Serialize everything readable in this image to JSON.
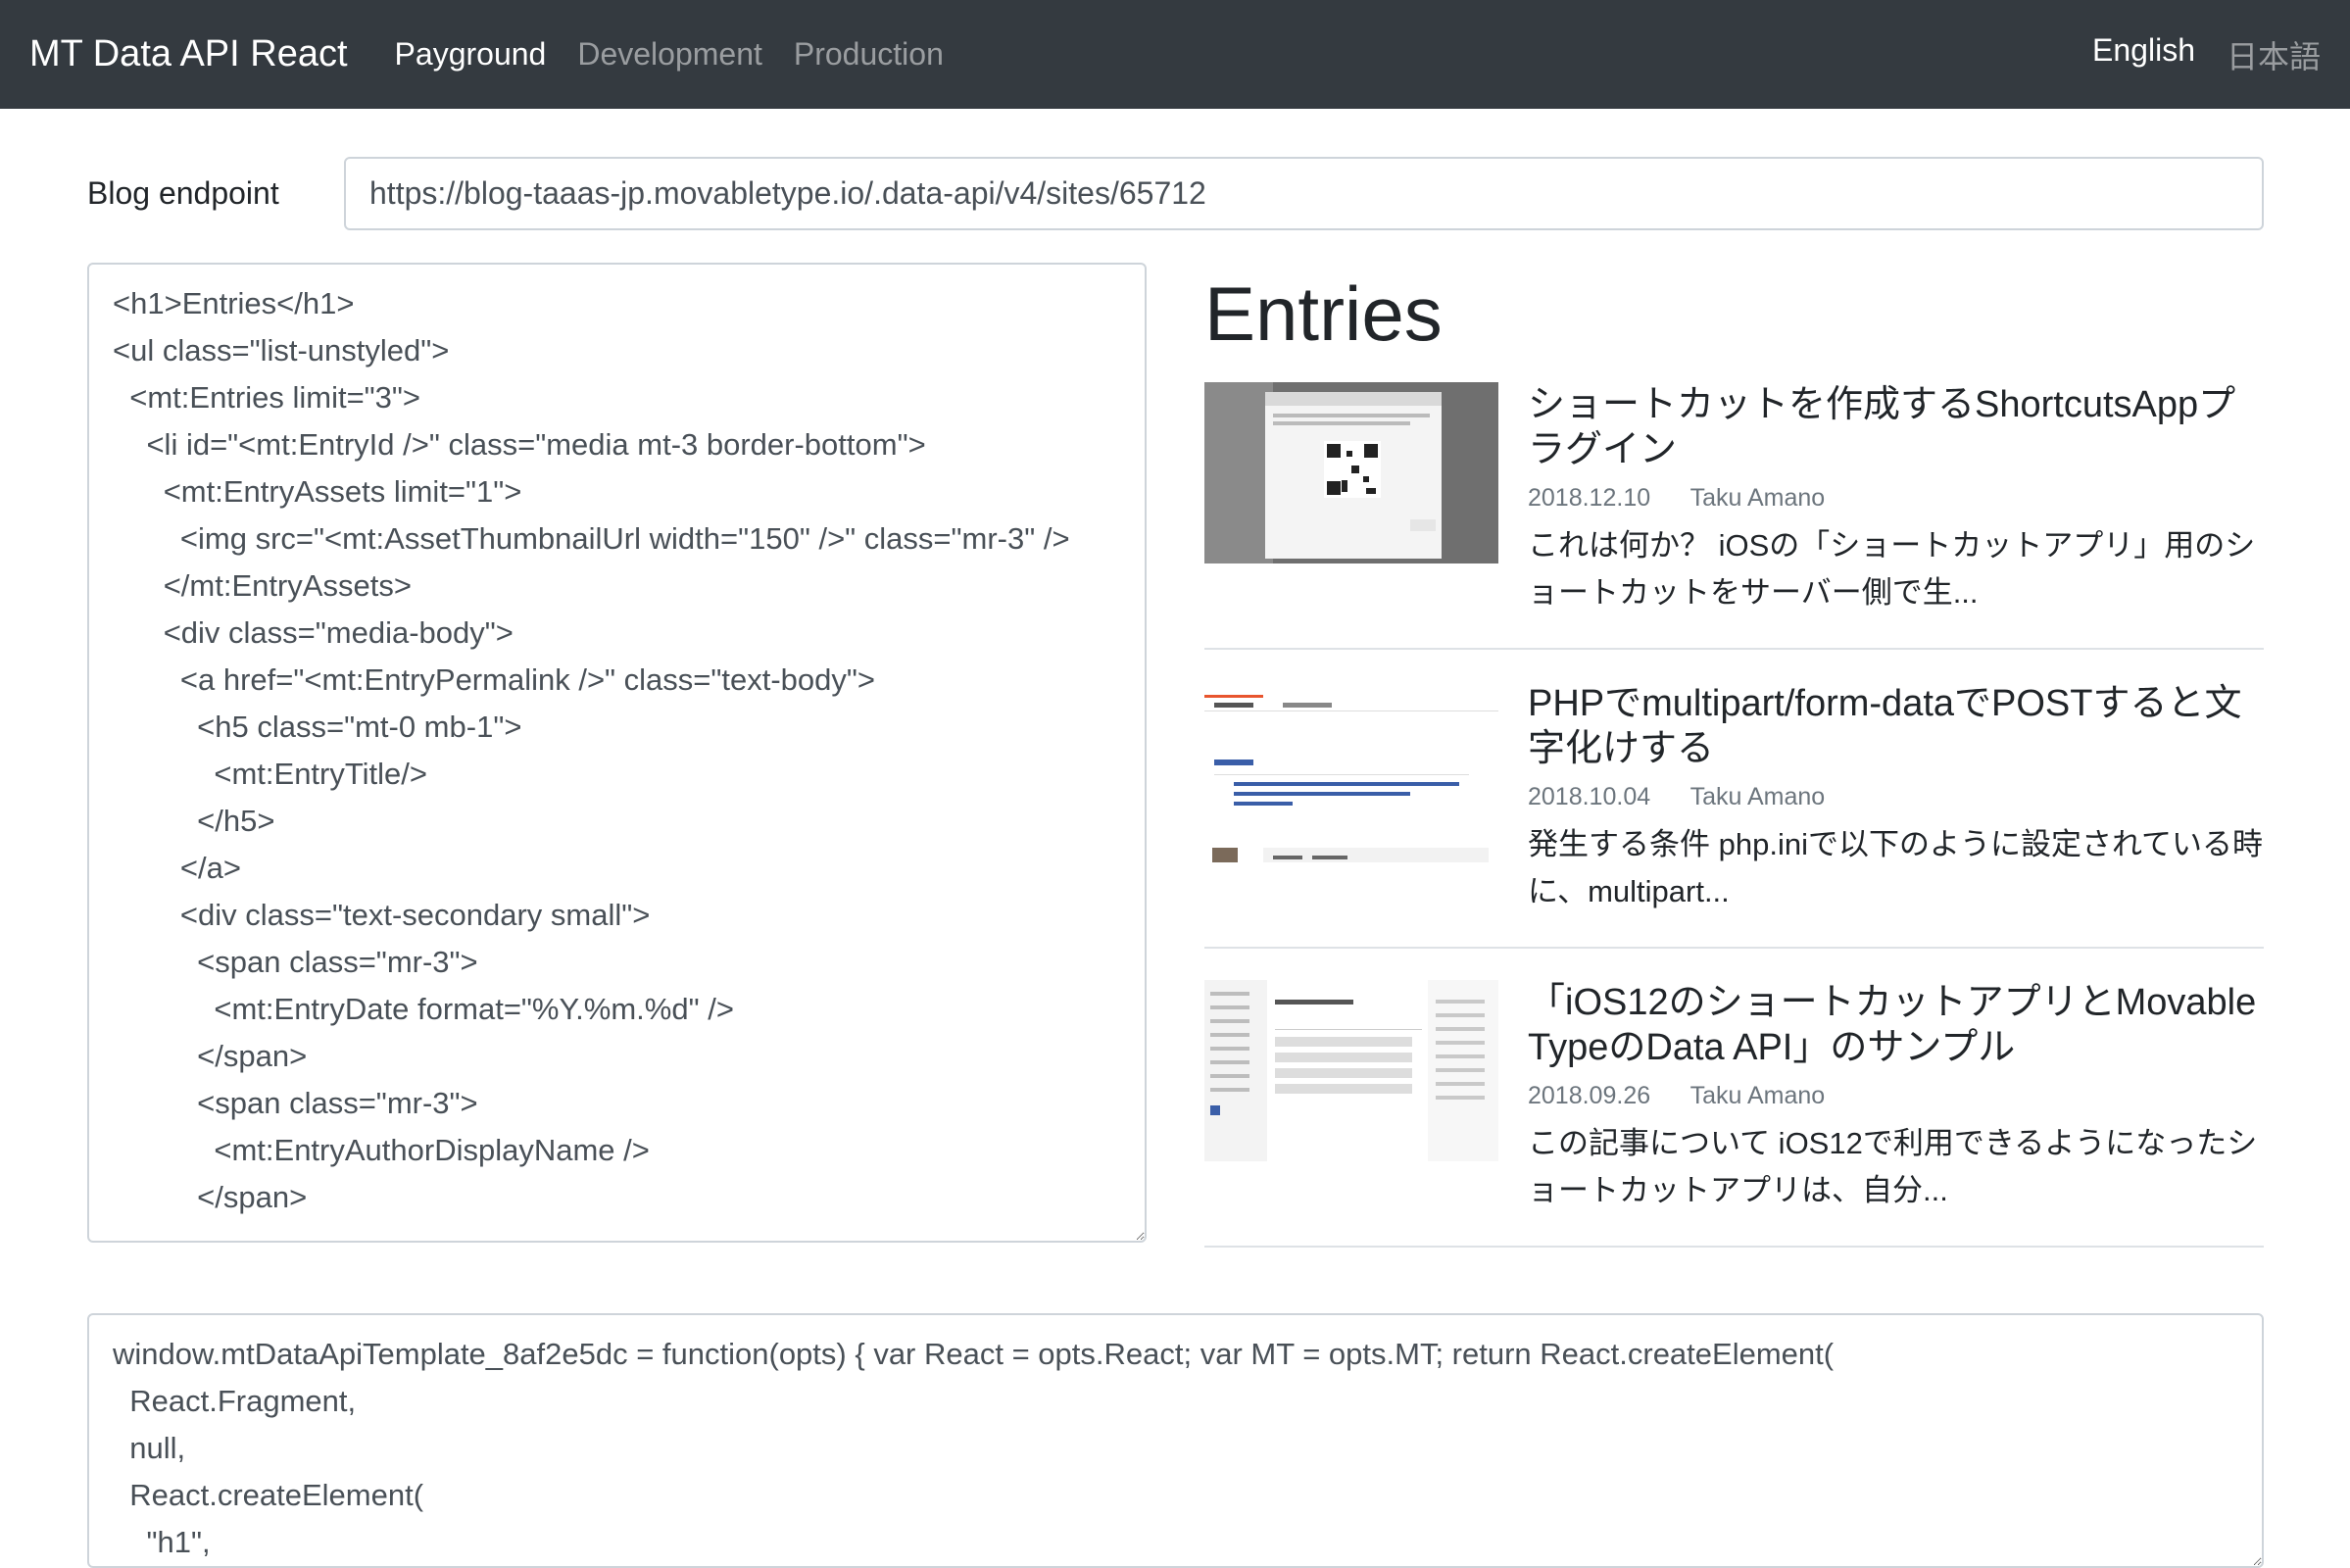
{
  "navbar": {
    "brand": "MT Data API React",
    "links": [
      {
        "label": "Payground",
        "active": true
      },
      {
        "label": "Development",
        "active": false
      },
      {
        "label": "Production",
        "active": false
      }
    ],
    "languages": [
      {
        "label": "English",
        "active": true
      },
      {
        "label": "日本語",
        "active": false
      }
    ]
  },
  "endpoint": {
    "label": "Blog endpoint",
    "value": "https://blog-taaas-jp.movabletype.io/.data-api/v4/sites/65712"
  },
  "template_source": "<h1>Entries</h1>\n<ul class=\"list-unstyled\">\n  <mt:Entries limit=\"3\">\n    <li id=\"<mt:EntryId />\" class=\"media mt-3 border-bottom\">\n      <mt:EntryAssets limit=\"1\">\n        <img src=\"<mt:AssetThumbnailUrl width=\"150\" />\" class=\"mr-3\" />\n      </mt:EntryAssets>\n      <div class=\"media-body\">\n        <a href=\"<mt:EntryPermalink />\" class=\"text-body\">\n          <h5 class=\"mt-0 mb-1\">\n            <mt:EntryTitle/>\n          </h5>\n        </a>\n        <div class=\"text-secondary small\">\n          <span class=\"mr-3\">\n            <mt:EntryDate format=\"%Y.%m.%d\" />\n          </span>\n          <span class=\"mr-3\">\n            <mt:EntryAuthorDisplayName />\n          </span>",
  "preview": {
    "heading": "Entries",
    "entries": [
      {
        "title": "ショートカットを作成するShortcutsAppプラグイン",
        "date": "2018.12.10",
        "author": "Taku Amano",
        "excerpt": "これは何か？ iOSの「ショートカットアプリ」用のショートカットをサーバー側で生..."
      },
      {
        "title": "PHPでmultipart/form-dataでPOSTすると文字化けする",
        "date": "2018.10.04",
        "author": "Taku Amano",
        "excerpt": "発生する条件 php.iniで以下のように設定されている時に、multipart..."
      },
      {
        "title": "「iOS12のショートカットアプリとMovable TypeのData API」のサンプル",
        "date": "2018.09.26",
        "author": "Taku Amano",
        "excerpt": "この記事について iOS12で利用できるようになったショートカットアプリは、自分..."
      }
    ]
  },
  "compiled_output": "window.mtDataApiTemplate_8af2e5dc = function(opts) { var React = opts.React; var MT = opts.MT; return React.createElement(\n  React.Fragment,\n  null,\n  React.createElement(\n    \"h1\","
}
